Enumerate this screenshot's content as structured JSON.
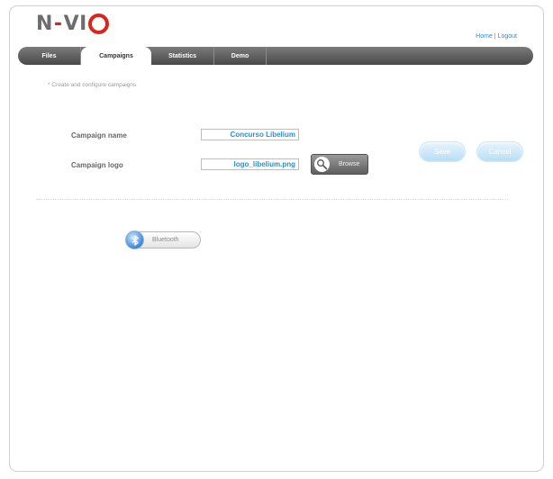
{
  "brand": {
    "logo_text_left": "N",
    "logo_dash": "-",
    "logo_text_right": "VI",
    "logo_ring": "O"
  },
  "toplinks": {
    "home": "Home",
    "separator": " | ",
    "logout": "Logout"
  },
  "nav": {
    "tabs": [
      {
        "label": "Files",
        "active": false
      },
      {
        "label": "Campaigns",
        "active": true
      },
      {
        "label": "Statistics",
        "active": false
      },
      {
        "label": "Demo",
        "active": false
      }
    ]
  },
  "page": {
    "hint": "* Create and configure campaigns"
  },
  "form": {
    "campaign_name_label": "Campaign name",
    "campaign_name_value": "Concurso Libelium",
    "campaign_logo_label": "Campaign logo",
    "campaign_logo_value": "logo_libelium.png",
    "browse_label": "Browse",
    "save_label": "Save",
    "cancel_label": "Cancel"
  },
  "channels": {
    "bluetooth_label": "Bluetooth"
  },
  "colors": {
    "accent_blue": "#2a8fd4",
    "logo_red": "#d9261c",
    "nav_gray": "#5a5a5a",
    "pill_blue": "#b9def4"
  },
  "icons": {
    "browse": "magnifier-icon",
    "bluetooth": "bluetooth-icon"
  }
}
